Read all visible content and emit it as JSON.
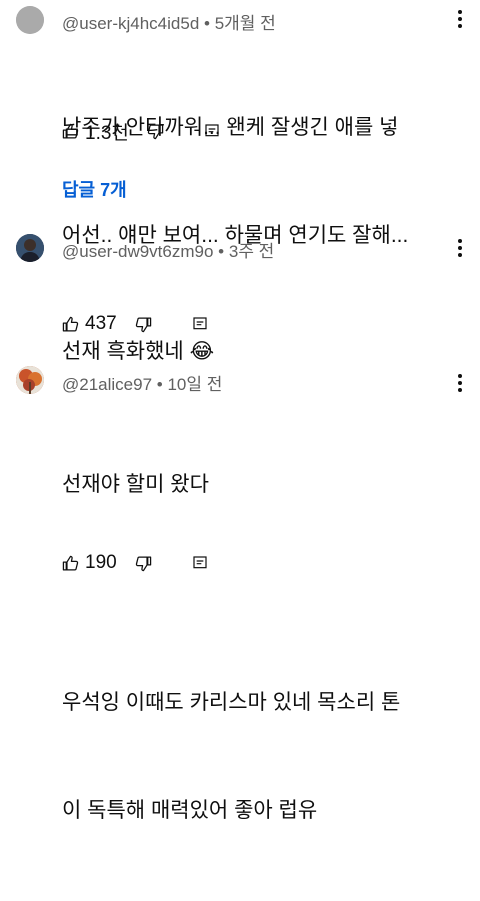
{
  "comments": [
    {
      "author": "@user-kj4hc4id5d",
      "separator": "•",
      "time": "5개월 전",
      "lines": [
        "남주가 안타까워... 왠케 잘생긴 애를 넣",
        "어선.. 얘만 보여... 하물며 연기도 잘해..."
      ],
      "likes": "1.3천",
      "replies": "답글 7개",
      "avatar_color": "#a9a9a9"
    },
    {
      "author": "@user-dw9vt6zm9o",
      "separator": "•",
      "time": "3주 전",
      "lines": [
        "선재 흑화했네 😂"
      ],
      "likes": "437",
      "avatar_color": "#2b3a55"
    },
    {
      "author": "@21alice97",
      "separator": "•",
      "time": "10일 전",
      "lines": [
        "선재야 할미 왔다",
        "",
        "우석잉 이때도 카리스마 있네 목소리 톤",
        "이 독특해 매력있어 좋아 럽유"
      ],
      "likes": "190",
      "avatar_color": "#c75a2e"
    }
  ]
}
